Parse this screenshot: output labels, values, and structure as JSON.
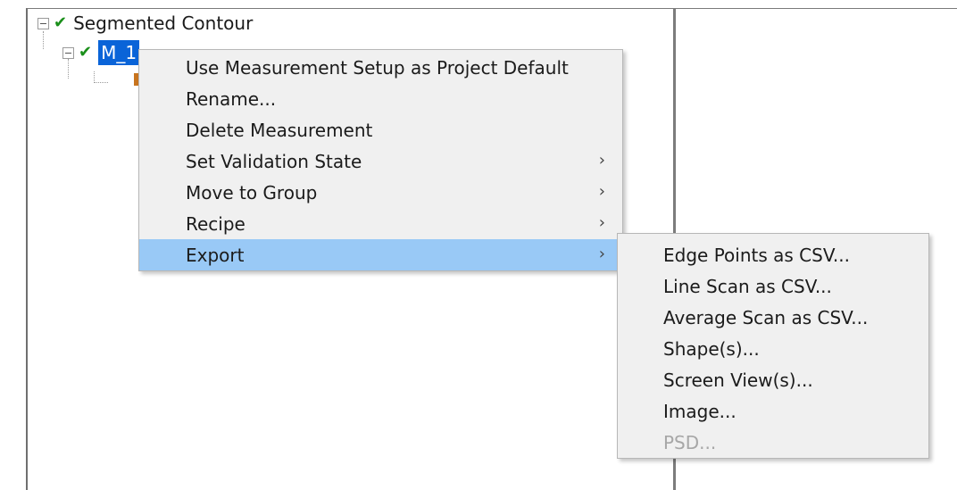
{
  "tree": {
    "root_label": "Segmented Contour",
    "child_label": "M_1"
  },
  "context_menu": {
    "items": [
      {
        "label": "Use Measurement Setup as Project Default",
        "has_submenu": false
      },
      {
        "label": "Rename...",
        "has_submenu": false
      },
      {
        "label": "Delete Measurement",
        "has_submenu": false
      },
      {
        "label": "Set Validation State",
        "has_submenu": true
      },
      {
        "label": "Move to Group",
        "has_submenu": true
      },
      {
        "label": "Recipe",
        "has_submenu": true
      },
      {
        "label": "Export",
        "has_submenu": true,
        "highlighted": true
      }
    ],
    "arrow_glyph": "›"
  },
  "export_submenu": {
    "items": [
      {
        "label": "Edge Points as CSV...",
        "enabled": true
      },
      {
        "label": "Line Scan as CSV...",
        "enabled": true
      },
      {
        "label": "Average Scan as CSV...",
        "enabled": true
      },
      {
        "label": "Shape(s)...",
        "enabled": true
      },
      {
        "label": "Screen View(s)...",
        "enabled": true
      },
      {
        "label": "Image...",
        "enabled": true
      },
      {
        "label": "PSD...",
        "enabled": false
      }
    ]
  },
  "colors": {
    "check_green": "#1a8f1a",
    "selection_blue": "#0a64d8",
    "menu_highlight": "#99c9f6",
    "disabled_text": "#a7a7a7",
    "menu_bg": "#f0f0f0"
  }
}
